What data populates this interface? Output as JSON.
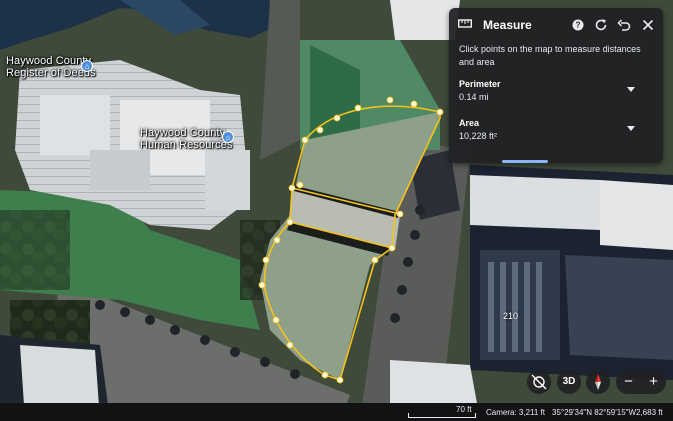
{
  "map": {
    "places": [
      {
        "name": "Haywood County Register of Deeds",
        "lines": [
          "Haywood County",
          "Register of Deeds"
        ]
      },
      {
        "name": "Haywood County Human Resources",
        "lines": [
          "Haywood County",
          "Human Resources"
        ]
      }
    ],
    "building_number": "210",
    "measure_outline_color": "#f4c21a",
    "vertex_color": "#fff7d6"
  },
  "measure": {
    "title": "Measure",
    "instructions": "Click points on the map to measure distances and area",
    "perimeter": {
      "label": "Perimeter",
      "value": "0.14 mi"
    },
    "area": {
      "label": "Area",
      "value": "10,228 ft²"
    },
    "icons": [
      "ruler-icon",
      "help-icon",
      "refresh-icon",
      "undo-icon",
      "close-icon"
    ],
    "accent": "#8ab4f8"
  },
  "controls": {
    "orbit_icon": "orbit-icon",
    "view_3d_label": "3D",
    "compass_icon": "compass-icon",
    "zoom_out_label": "−",
    "zoom_in_label": "+"
  },
  "status": {
    "scale": "70 ft",
    "camera": "Camera: 3,211 ft",
    "coords": "35°29'34\"N 82°59'15\"W",
    "elevation": "2,683 ft"
  }
}
